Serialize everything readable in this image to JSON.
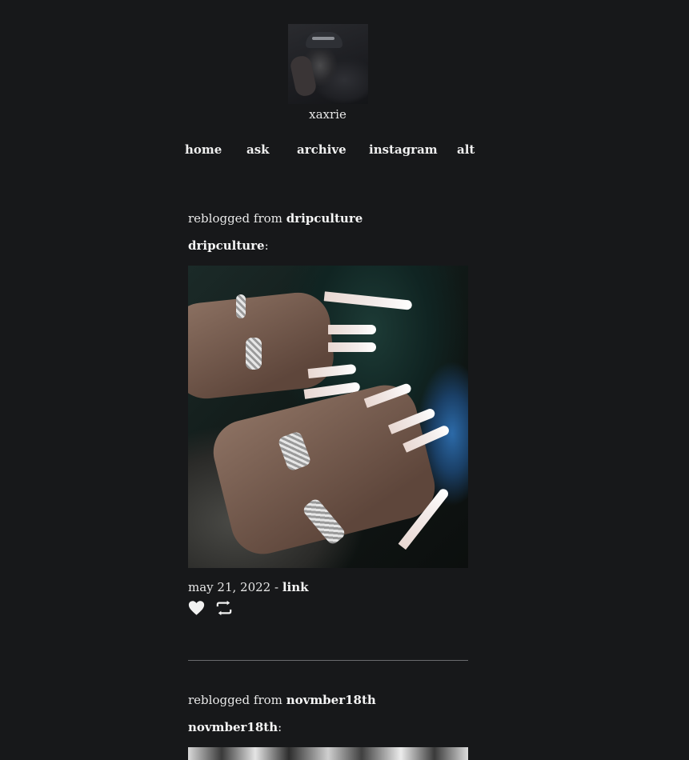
{
  "blog": {
    "username": "xaxrie"
  },
  "nav": {
    "items": [
      {
        "label": "home"
      },
      {
        "label": "ask"
      },
      {
        "label": "archive"
      },
      {
        "label": "instagram"
      },
      {
        "label": "alt"
      }
    ]
  },
  "posts": [
    {
      "reblog_prefix": "reblogged from",
      "reblog_source": "dripculture",
      "source_name": "dripculture",
      "source_suffix": ":",
      "date": "may 21, 2022",
      "date_separator": " - ",
      "link_label": "link",
      "icons": [
        "heart-icon",
        "reblog-icon"
      ]
    },
    {
      "reblog_prefix": "reblogged from",
      "reblog_source": "novmber18th",
      "source_name": "novmber18th",
      "source_suffix": ":"
    }
  ],
  "colors": {
    "background": "#17181a",
    "text": "#e8e8e8",
    "divider": "#6a6b6e"
  }
}
